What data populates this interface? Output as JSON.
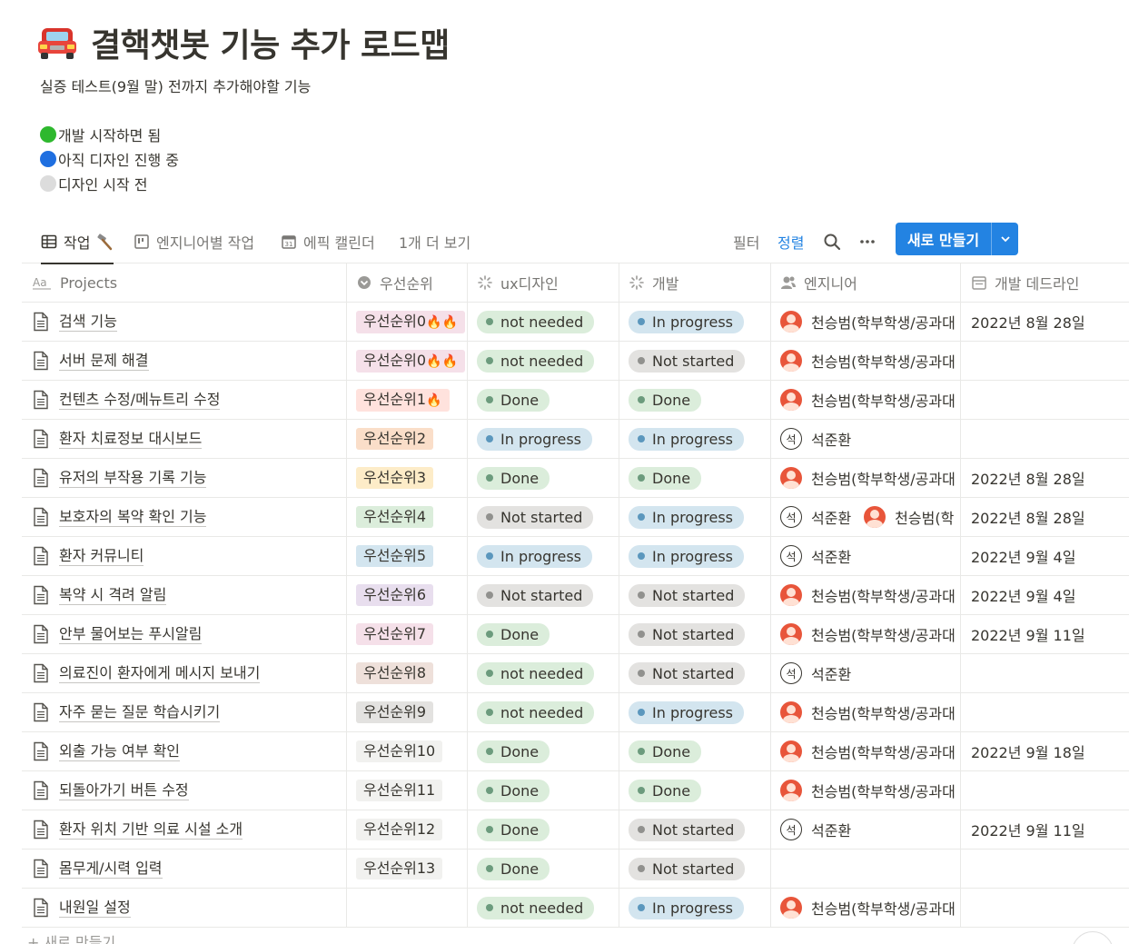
{
  "page": {
    "emoji": "car-icon",
    "title": "결핵챗봇 기능 추가 로드맵",
    "description": "실증 테스트(9월 말) 전까지 추가해야할 기능",
    "legend": [
      {
        "color": "#2eb82e",
        "text": "개발 시작하면 됨"
      },
      {
        "color": "#1f6fe0",
        "text": "아직 디자인 진행 중"
      },
      {
        "color": "#dcdcdc",
        "text": "디자인 시작 전"
      }
    ]
  },
  "views": {
    "tabs": [
      {
        "label": "작업",
        "icon": "table-icon",
        "suffix_icon": "hammer-icon"
      },
      {
        "label": "엔지니어별 작업",
        "icon": "board-icon"
      },
      {
        "label": "에픽 캘린더",
        "icon": "calendar-icon"
      },
      {
        "label": "1개 더 보기"
      }
    ],
    "filter_label": "필터",
    "sort_label": "정렬",
    "new_button_label": "새로 만들기",
    "accent": "#2383e2"
  },
  "table": {
    "columns": [
      "Projects",
      "우선순위",
      "ux디자인",
      "개발",
      "엔지니어",
      "개발 데드라인"
    ],
    "rows": [
      {
        "name": "검색 기능",
        "priority": "우선순위0",
        "fire": "🔥🔥",
        "pc": "#f5e0e9",
        "ux": "not needed",
        "uxs": "green",
        "dev": "In progress",
        "devs": "blue",
        "eng": [
          {
            "n": "천승범(학부학생/공과대",
            "a": "photo"
          }
        ],
        "deadline": "2022년 8월 28일"
      },
      {
        "name": "서버 문제 해결",
        "priority": "우선순위0",
        "fire": "🔥🔥",
        "pc": "#f5e0e9",
        "ux": "not needed",
        "uxs": "green",
        "dev": "Not started",
        "devs": "gray",
        "eng": [
          {
            "n": "천승범(학부학생/공과대",
            "a": "photo"
          }
        ],
        "deadline": ""
      },
      {
        "name": "컨텐츠 수정/메뉴트리 수정",
        "priority": "우선순위1",
        "fire": "🔥",
        "pc": "#ffe2dd",
        "ux": "Done",
        "uxs": "green",
        "dev": "Done",
        "devs": "green",
        "eng": [
          {
            "n": "천승범(학부학생/공과대",
            "a": "photo"
          }
        ],
        "deadline": ""
      },
      {
        "name": "환자 치료정보 대시보드",
        "priority": "우선순위2",
        "fire": "",
        "pc": "#fadec9",
        "ux": "In progress",
        "uxs": "blue",
        "dev": "In progress",
        "devs": "blue",
        "eng": [
          {
            "n": "석준환",
            "a": "석"
          }
        ],
        "deadline": ""
      },
      {
        "name": "유저의 부작용 기록 기능",
        "priority": "우선순위3",
        "fire": "",
        "pc": "#fdecc8",
        "ux": "Done",
        "uxs": "green",
        "dev": "Done",
        "devs": "green",
        "eng": [
          {
            "n": "천승범(학부학생/공과대",
            "a": "photo"
          }
        ],
        "deadline": "2022년 8월 28일"
      },
      {
        "name": "보호자의 복약 확인 기능",
        "priority": "우선순위4",
        "fire": "",
        "pc": "#dbeddb",
        "ux": "Not started",
        "uxs": "gray",
        "dev": "In progress",
        "devs": "blue",
        "eng": [
          {
            "n": "석준환",
            "a": "석"
          },
          {
            "n": "천승범(학",
            "a": "photo"
          }
        ],
        "deadline": "2022년 8월 28일"
      },
      {
        "name": "환자 커뮤니티",
        "priority": "우선순위5",
        "fire": "",
        "pc": "#d3e5ef",
        "ux": "In progress",
        "uxs": "blue",
        "dev": "In progress",
        "devs": "blue",
        "eng": [
          {
            "n": "석준환",
            "a": "석"
          }
        ],
        "deadline": "2022년 9월 4일"
      },
      {
        "name": "복약 시 격려 알림",
        "priority": "우선순위6",
        "fire": "",
        "pc": "#e8deee",
        "ux": "Not started",
        "uxs": "gray",
        "dev": "Not started",
        "devs": "gray",
        "eng": [
          {
            "n": "천승범(학부학생/공과대",
            "a": "photo"
          }
        ],
        "deadline": "2022년 9월 4일"
      },
      {
        "name": "안부 물어보는 푸시알림",
        "priority": "우선순위7",
        "fire": "",
        "pc": "#f5e0e9",
        "ux": "Done",
        "uxs": "green",
        "dev": "Not started",
        "devs": "gray",
        "eng": [
          {
            "n": "천승범(학부학생/공과대",
            "a": "photo"
          }
        ],
        "deadline": "2022년 9월 11일"
      },
      {
        "name": "의료진이 환자에게 메시지 보내기",
        "priority": "우선순위8",
        "fire": "",
        "pc": "#eee0da",
        "ux": "not needed",
        "uxs": "green",
        "dev": "Not started",
        "devs": "gray",
        "eng": [
          {
            "n": "석준환",
            "a": "석"
          }
        ],
        "deadline": ""
      },
      {
        "name": "자주 묻는 질문 학습시키기",
        "priority": "우선순위9",
        "fire": "",
        "pc": "#e3e2e0",
        "ux": "not needed",
        "uxs": "green",
        "dev": "In progress",
        "devs": "blue",
        "eng": [
          {
            "n": "천승범(학부학생/공과대",
            "a": "photo"
          }
        ],
        "deadline": ""
      },
      {
        "name": "외출 가능 여부 확인",
        "priority": "우선순위10",
        "fire": "",
        "pc": "#f1f1ef",
        "ux": "Done",
        "uxs": "green",
        "dev": "Done",
        "devs": "green",
        "eng": [
          {
            "n": "천승범(학부학생/공과대",
            "a": "photo"
          }
        ],
        "deadline": "2022년 9월 18일"
      },
      {
        "name": "되돌아가기 버튼 수정",
        "priority": "우선순위11",
        "fire": "",
        "pc": "#f1f1ef",
        "ux": "Done",
        "uxs": "green",
        "dev": "Done",
        "devs": "green",
        "eng": [
          {
            "n": "천승범(학부학생/공과대",
            "a": "photo"
          }
        ],
        "deadline": ""
      },
      {
        "name": "환자 위치 기반 의료 시설 소개",
        "priority": "우선순위12",
        "fire": "",
        "pc": "#f1f1ef",
        "ux": "Done",
        "uxs": "green",
        "dev": "Not started",
        "devs": "gray",
        "eng": [
          {
            "n": "석준환",
            "a": "석"
          }
        ],
        "deadline": "2022년 9월 11일"
      },
      {
        "name": "몸무게/시력 입력",
        "priority": "우선순위13",
        "fire": "",
        "pc": "#f1f1ef",
        "ux": "Done",
        "uxs": "green",
        "dev": "Not started",
        "devs": "gray",
        "eng": [],
        "deadline": ""
      },
      {
        "name": "내원일 설정",
        "priority": "",
        "fire": "",
        "pc": "",
        "ux": "not needed",
        "uxs": "green",
        "dev": "In progress",
        "devs": "blue",
        "eng": [
          {
            "n": "천승범(학부학생/공과대",
            "a": "photo"
          }
        ],
        "deadline": ""
      }
    ],
    "add_row_label": "+ 새로 만들기"
  }
}
